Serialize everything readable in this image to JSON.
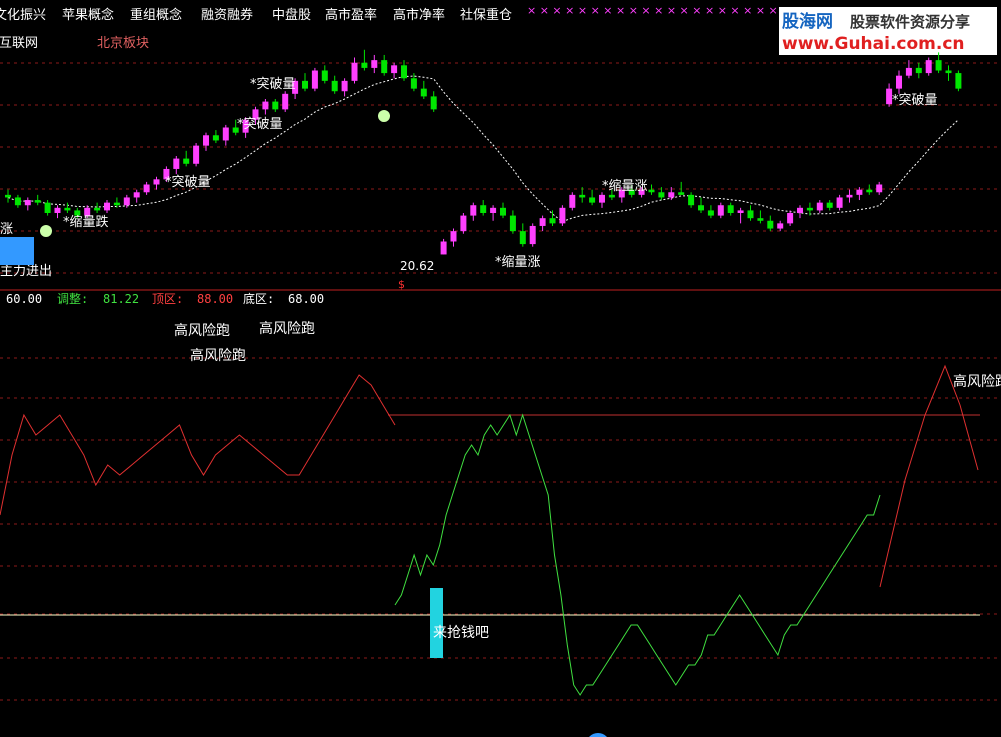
{
  "tags": [
    "文化振兴",
    "苹果概念",
    "重组概念",
    "融资融券",
    "中盘股",
    "高市盈率",
    "高市净率",
    "社保重仓"
  ],
  "markers": "× × × × × × × × × × × × × × × × × × × ×",
  "sub_tags": [
    "互联网",
    "北京板块"
  ],
  "watermark": {
    "name": "股海网",
    "slogan": "股票软件资源分享",
    "url": "www.Guhai.com.cn"
  },
  "indicator_header": {
    "first_value": "60.00",
    "items": [
      {
        "label": "调整:",
        "value": "81.22"
      },
      {
        "label": "顶区:",
        "value": "88.00"
      },
      {
        "label": "底区:",
        "value": "68.00"
      }
    ]
  },
  "colors": {
    "up": "#ff40ff",
    "down": "#00e600",
    "doji": "#ffff66",
    "ma": "#ffffff",
    "osc_high": "#e03030",
    "osc_low": "#40e040",
    "ref_top": "#c03030",
    "ref_bottom": "#ffffcc",
    "grid": "#8b1a1a",
    "cyan": "#22d3e0"
  },
  "chart_data": [
    {
      "type": "candlestick",
      "annotations": [
        "涨",
        "*缩量跌",
        "*突破量",
        "*突破量",
        "*突破量",
        "20.62",
        "*缩量涨",
        "*缩量涨",
        "*突破量",
        "主力进出"
      ],
      "price_label": "20.62",
      "candles": [
        [
          22.9,
          23.1,
          22.6,
          22.8
        ],
        [
          22.8,
          22.9,
          22.4,
          22.5
        ],
        [
          22.5,
          22.8,
          22.3,
          22.7
        ],
        [
          22.7,
          22.9,
          22.5,
          22.6
        ],
        [
          22.6,
          22.7,
          22.1,
          22.2
        ],
        [
          22.2,
          22.5,
          22.0,
          22.4
        ],
        [
          22.4,
          22.6,
          22.2,
          22.3
        ],
        [
          22.3,
          22.4,
          22.0,
          22.1
        ],
        [
          22.1,
          22.5,
          22.0,
          22.4
        ],
        [
          22.4,
          22.6,
          22.2,
          22.3
        ],
        [
          22.3,
          22.7,
          22.2,
          22.6
        ],
        [
          22.6,
          22.8,
          22.4,
          22.5
        ],
        [
          22.5,
          22.9,
          22.4,
          22.8
        ],
        [
          22.8,
          23.1,
          22.6,
          23.0
        ],
        [
          23.0,
          23.4,
          22.9,
          23.3
        ],
        [
          23.3,
          23.6,
          23.1,
          23.5
        ],
        [
          23.5,
          24.0,
          23.4,
          23.9
        ],
        [
          23.9,
          24.4,
          23.7,
          24.3
        ],
        [
          24.3,
          24.6,
          24.0,
          24.1
        ],
        [
          24.1,
          24.9,
          24.0,
          24.8
        ],
        [
          24.8,
          25.3,
          24.6,
          25.2
        ],
        [
          25.2,
          25.4,
          24.9,
          25.0
        ],
        [
          25.0,
          25.6,
          24.8,
          25.5
        ],
        [
          25.5,
          25.8,
          25.2,
          25.3
        ],
        [
          25.3,
          25.9,
          25.1,
          25.8
        ],
        [
          25.8,
          26.3,
          25.6,
          26.2
        ],
        [
          26.2,
          26.6,
          26.0,
          26.5
        ],
        [
          26.5,
          26.6,
          26.1,
          26.2
        ],
        [
          26.2,
          26.9,
          26.1,
          26.8
        ],
        [
          26.8,
          27.4,
          26.6,
          27.3
        ],
        [
          27.3,
          27.6,
          26.9,
          27.0
        ],
        [
          27.0,
          27.8,
          26.9,
          27.7
        ],
        [
          27.7,
          27.9,
          27.2,
          27.3
        ],
        [
          27.3,
          27.5,
          26.8,
          26.9
        ],
        [
          26.9,
          27.4,
          26.7,
          27.3
        ],
        [
          27.3,
          28.2,
          27.2,
          28.0
        ],
        [
          28.0,
          28.5,
          27.7,
          27.8
        ],
        [
          27.8,
          28.3,
          27.6,
          28.1
        ],
        [
          28.1,
          28.3,
          27.5,
          27.6
        ],
        [
          27.6,
          28.0,
          27.4,
          27.9
        ],
        [
          27.9,
          28.1,
          27.3,
          27.4
        ],
        [
          27.4,
          27.6,
          26.9,
          27.0
        ],
        [
          27.0,
          27.3,
          26.6,
          26.7
        ],
        [
          26.7,
          26.9,
          26.1,
          26.2
        ],
        [
          20.6,
          21.2,
          20.6,
          21.1
        ],
        [
          21.1,
          21.6,
          20.9,
          21.5
        ],
        [
          21.5,
          22.2,
          21.4,
          22.1
        ],
        [
          22.1,
          22.6,
          21.9,
          22.5
        ],
        [
          22.5,
          22.7,
          22.1,
          22.2
        ],
        [
          22.2,
          22.5,
          21.9,
          22.4
        ],
        [
          22.4,
          22.6,
          22.0,
          22.1
        ],
        [
          22.1,
          22.3,
          21.4,
          21.5
        ],
        [
          21.5,
          21.8,
          20.9,
          21.0
        ],
        [
          21.0,
          21.8,
          20.9,
          21.7
        ],
        [
          21.7,
          22.1,
          21.5,
          22.0
        ],
        [
          22.0,
          22.3,
          21.7,
          21.8
        ],
        [
          21.8,
          22.5,
          21.7,
          22.4
        ],
        [
          22.4,
          23.0,
          22.3,
          22.9
        ],
        [
          22.9,
          23.2,
          22.6,
          22.8
        ],
        [
          22.8,
          23.1,
          22.5,
          22.6
        ],
        [
          22.6,
          23.0,
          22.4,
          22.9
        ],
        [
          22.9,
          23.1,
          22.7,
          22.8
        ],
        [
          22.8,
          23.2,
          22.6,
          23.1
        ],
        [
          23.1,
          23.3,
          22.8,
          22.9
        ],
        [
          22.9,
          23.2,
          22.8,
          23.1
        ],
        [
          23.1,
          23.3,
          22.9,
          23.0
        ],
        [
          23.0,
          23.2,
          22.7,
          22.8
        ],
        [
          22.8,
          23.2,
          22.7,
          23.0
        ],
        [
          23.0,
          23.4,
          22.9,
          22.9
        ],
        [
          22.9,
          23.0,
          22.4,
          22.5
        ],
        [
          22.5,
          22.8,
          22.2,
          22.3
        ],
        [
          22.3,
          22.5,
          22.0,
          22.1
        ],
        [
          22.1,
          22.6,
          22.0,
          22.5
        ],
        [
          22.5,
          22.6,
          22.1,
          22.2
        ],
        [
          22.2,
          22.4,
          21.8,
          22.3
        ],
        [
          22.3,
          22.5,
          21.9,
          22.0
        ],
        [
          22.0,
          22.3,
          21.8,
          21.9
        ],
        [
          21.9,
          22.1,
          21.5,
          21.6
        ],
        [
          21.6,
          21.9,
          21.5,
          21.8
        ],
        [
          21.8,
          22.3,
          21.7,
          22.2
        ],
        [
          22.2,
          22.5,
          22.0,
          22.4
        ],
        [
          22.4,
          22.6,
          22.1,
          22.3
        ],
        [
          22.3,
          22.7,
          22.2,
          22.6
        ],
        [
          22.6,
          22.7,
          22.3,
          22.4
        ],
        [
          22.4,
          22.9,
          22.3,
          22.8
        ],
        [
          22.8,
          23.1,
          22.6,
          22.9
        ],
        [
          22.9,
          23.2,
          22.7,
          23.1
        ],
        [
          23.1,
          23.3,
          22.9,
          23.0
        ],
        [
          23.0,
          23.4,
          22.9,
          23.3
        ],
        [
          26.4,
          27.2,
          26.3,
          27.0
        ],
        [
          27.0,
          27.7,
          26.8,
          27.5
        ],
        [
          27.5,
          28.1,
          27.4,
          27.8
        ],
        [
          27.8,
          28.0,
          27.4,
          27.6
        ],
        [
          27.6,
          28.2,
          27.5,
          28.1
        ],
        [
          28.1,
          28.4,
          27.6,
          27.7
        ],
        [
          27.7,
          27.9,
          27.3,
          27.6
        ],
        [
          27.6,
          27.7,
          26.9,
          27.0
        ]
      ]
    },
    {
      "type": "line",
      "series": [
        {
          "values": [
            69,
            70,
            72,
            74,
            72,
            74,
            73,
            75,
            78,
            80,
            82,
            84,
            85,
            84,
            86,
            87,
            86,
            87,
            88,
            86,
            88,
            86,
            84,
            82,
            80,
            74,
            70,
            65,
            61,
            60,
            61,
            61,
            62,
            63,
            64,
            65,
            66,
            67,
            67,
            66,
            65,
            64,
            63,
            62,
            61,
            62,
            63,
            63,
            64,
            66,
            66,
            67,
            68,
            69,
            70,
            69,
            68,
            67,
            66,
            65,
            64,
            66,
            67,
            67,
            68,
            69,
            70,
            71,
            72,
            73,
            74,
            75,
            76,
            77,
            78,
            78,
            80
          ]
        },
        {
          "values": [
            78,
            84,
            88,
            86,
            87,
            88,
            86,
            84,
            81,
            83,
            82,
            83,
            84,
            85,
            86,
            87,
            84,
            82,
            84,
            85,
            86,
            85,
            84,
            83,
            82,
            82,
            84,
            86,
            88,
            90,
            92,
            91,
            89,
            87
          ]
        }
      ],
      "reference_lines": [
        88,
        68
      ]
    }
  ]
}
